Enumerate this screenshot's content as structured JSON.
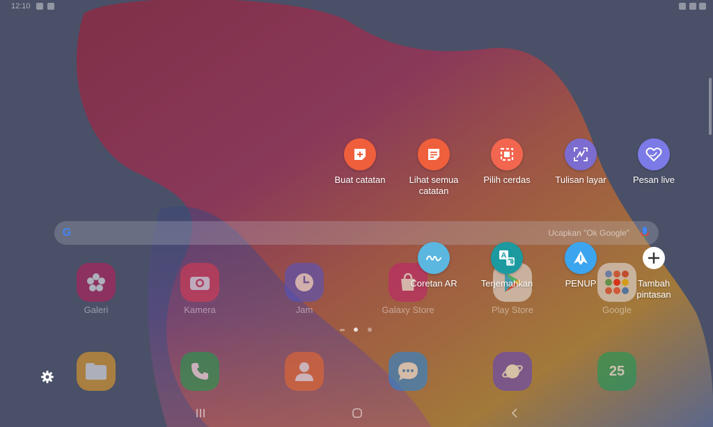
{
  "status_bar": {
    "time": "12:10"
  },
  "air_command": {
    "items": [
      {
        "label": "Buat catatan",
        "icon": "create-note-icon",
        "color": "#ef5f3c"
      },
      {
        "label": "Lihat semua\ncatatan",
        "icon": "view-notes-icon",
        "color": "#ef5f3c"
      },
      {
        "label": "Pilih cerdas",
        "icon": "smart-select-icon",
        "color": "#f26650"
      },
      {
        "label": "Tulisan layar",
        "icon": "screen-write-icon",
        "color": "#7c6ccf"
      },
      {
        "label": "Pesan live",
        "icon": "live-message-icon",
        "color": "#7c7ae6"
      },
      {
        "label": "Coretan AR",
        "icon": "ar-doodle-icon",
        "color": "#5bb7e0"
      },
      {
        "label": "Terjemahkan",
        "icon": "translate-icon",
        "color": "#1c9aa0"
      },
      {
        "label": "PENUP",
        "icon": "penup-icon",
        "color": "#3ca5ef"
      },
      {
        "label": "Tambah\npintasan",
        "icon": "add-shortcut-icon",
        "color": "#ffffff"
      }
    ]
  },
  "search": {
    "hint": "Ucapkan \"Ok Google\""
  },
  "apps": {
    "row1": [
      {
        "label": "Galeri",
        "icon": "gallery-icon",
        "color": "#c2185b"
      },
      {
        "label": "Kamera",
        "icon": "camera-icon",
        "color": "#e53950"
      },
      {
        "label": "Jam",
        "icon": "clock-icon",
        "color": "#4d55c9"
      },
      {
        "label": "Galaxy Store",
        "icon": "galaxy-store-icon",
        "color": "#c31f6f"
      },
      {
        "label": "Play Store",
        "icon": "play-store-icon",
        "color": "#eeeeee"
      },
      {
        "label": "Google",
        "icon": "google-folder-icon",
        "color": "#e8e8ec"
      }
    ],
    "dock": [
      {
        "label": "",
        "icon": "my-files-icon",
        "color": "#f5a623"
      },
      {
        "label": "",
        "icon": "phone-icon",
        "color": "#16a34a"
      },
      {
        "label": "",
        "icon": "contacts-icon",
        "color": "#f06a2b"
      },
      {
        "label": "",
        "icon": "messages-icon",
        "color": "#1e88e5"
      },
      {
        "label": "",
        "icon": "internet-icon",
        "color": "#5c3ec8"
      },
      {
        "label": "25",
        "icon": "calendar-icon",
        "color": "#0f9d58"
      }
    ]
  }
}
